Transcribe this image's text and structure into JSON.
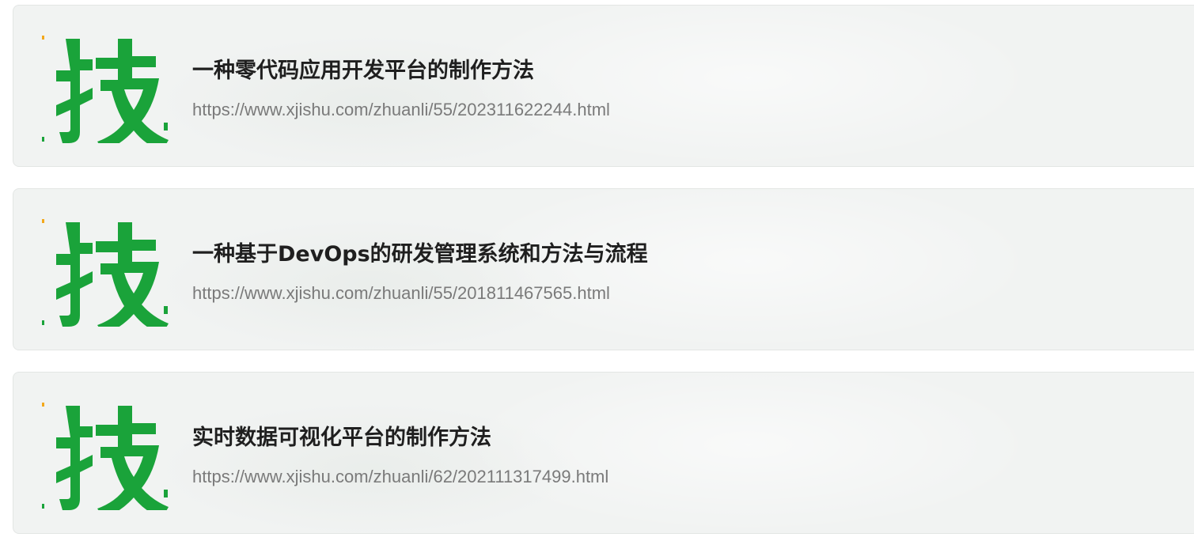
{
  "results": [
    {
      "thumbnail_icon": "ji-character-logo-icon",
      "thumbnail_char": "技",
      "title": "一种零代码应用开发平台的制作方法",
      "url": "https://www.xjishu.com/zhuanli/55/202311622244.html"
    },
    {
      "thumbnail_icon": "ji-character-logo-icon",
      "thumbnail_char": "技",
      "title": "一种基于DevOps的研发管理系统和方法与流程",
      "url": "https://www.xjishu.com/zhuanli/55/201811467565.html"
    },
    {
      "thumbnail_icon": "ji-character-logo-icon",
      "thumbnail_char": "技",
      "title": "实时数据可视化平台的制作方法",
      "url": "https://www.xjishu.com/zhuanli/62/202111317499.html"
    }
  ],
  "colors": {
    "logo_green": "#1aa33a",
    "logo_accent": "#f3a81c",
    "card_bg": "#f1f3f2",
    "title": "#1f1f1f",
    "url": "#7a7a7a"
  }
}
